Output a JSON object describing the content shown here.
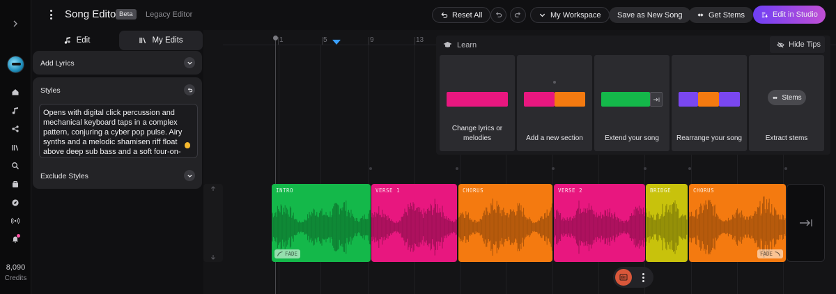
{
  "header": {
    "title": "Song Editor",
    "badge": "Beta",
    "legacy_link": "Legacy Editor",
    "reset_all": "Reset All",
    "workspace": "My Workspace",
    "save_as_new": "Save as New Song",
    "get_stems": "Get Stems",
    "edit_in_studio": "Edit in Studio"
  },
  "sidebar": {
    "credits_value": "8,090",
    "credits_label": "Credits",
    "icons": [
      "home-icon",
      "music-note-icon",
      "share-nodes-icon",
      "library-icon",
      "search-icon",
      "inbox-icon",
      "compass-icon",
      "radio-icon",
      "bell-icon"
    ]
  },
  "left_panel": {
    "tabs": [
      {
        "label": "Edit",
        "active": false
      },
      {
        "label": "My Edits",
        "active": true
      }
    ],
    "add_lyrics": "Add Lyrics",
    "styles_label": "Styles",
    "styles_text": "Opens with digital click percussion and mechanical keyboard taps in a complex pattern, conjuring a cyber pop pulse. Airy synths and a melodic shamisen riff float above deep sub bass and a soft four-on-the-floor",
    "exclude_styles": "Exclude Styles"
  },
  "timeline": {
    "ruler_ticks": [
      "1",
      "5",
      "9",
      "13"
    ]
  },
  "tips": {
    "learn": "Learn",
    "hide_tips": "Hide Tips",
    "cards": [
      {
        "caption": "Change lyrics or melodies"
      },
      {
        "caption": "Add a new section"
      },
      {
        "caption": "Extend your song"
      },
      {
        "caption": "Rearrange your song"
      },
      {
        "caption": "Extract stems",
        "pill": "Stems"
      }
    ]
  },
  "clips": [
    {
      "label": "INTRO",
      "color": "#14b84a",
      "fade": "FADE"
    },
    {
      "label": "VERSE 1",
      "color": "#e8177f"
    },
    {
      "label": "CHORUS",
      "color": "#f47a10"
    },
    {
      "label": "VERSE 2",
      "color": "#e8177f"
    },
    {
      "label": "BRIDGE",
      "color": "#c8c20c"
    },
    {
      "label": "CHORUS",
      "color": "#f47a10",
      "fade": "FADE"
    }
  ]
}
